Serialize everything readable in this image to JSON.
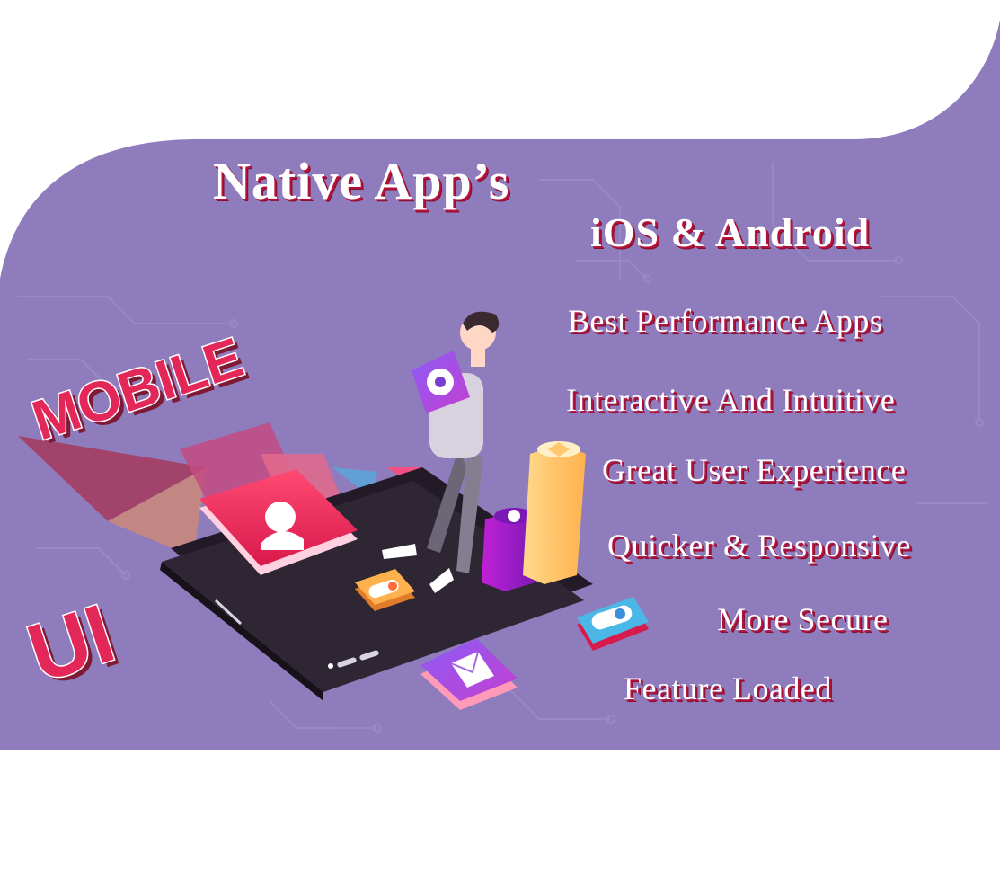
{
  "title": "Native App’s",
  "subtitle": "iOS & Android",
  "features": [
    "Best Performance Apps",
    "Interactive And Intuitive",
    "Great User Experience",
    "Quicker & Responsive",
    "More Secure",
    "Feature Loaded"
  ],
  "illustration": {
    "word_mobile": "MOBILE",
    "word_ui": "UI",
    "icons": [
      "user-icon",
      "gear-icon",
      "mail-icon",
      "chart-icon",
      "toggle-icon"
    ]
  },
  "colors": {
    "background": "#ffffff",
    "panel": "#8f7cbd",
    "text": "#ffffff",
    "text_shadow": "#b3123c",
    "accent_pink": "#e32759",
    "phone": "#2f2634",
    "bar_yellow": "#ffc870",
    "bar_purple": "#a21fd1"
  }
}
